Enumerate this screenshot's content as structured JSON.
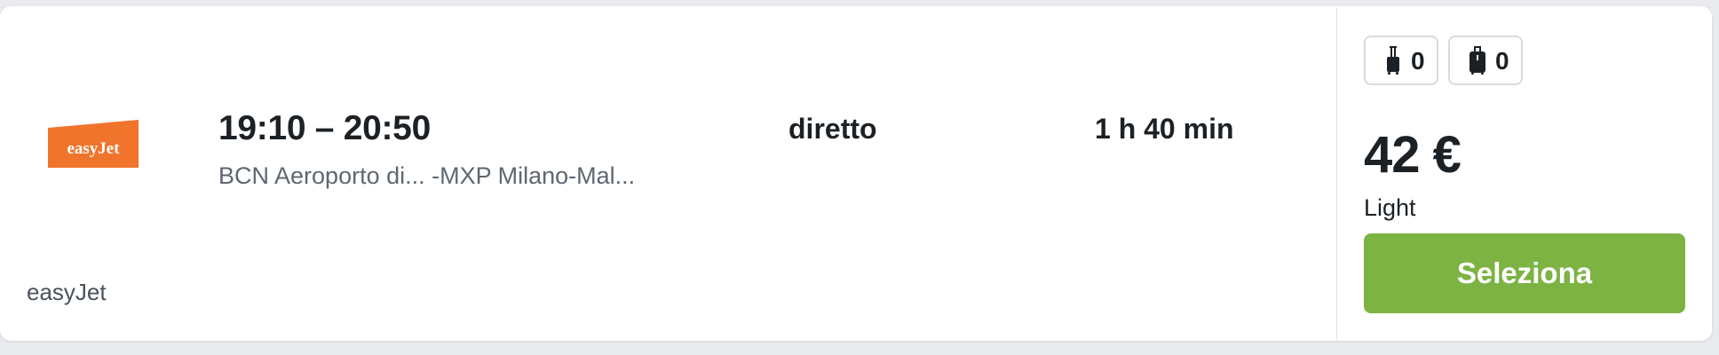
{
  "flight": {
    "airline": {
      "logo_text": "easyJet",
      "name": "easyJet",
      "brand_color": "#f0742c"
    },
    "time_range": "19:10 – 20:50",
    "route": "BCN Aeroporto di... -MXP Milano-Mal...",
    "stops": "diretto",
    "duration": "1 h 40 min"
  },
  "fare": {
    "baggage": [
      {
        "icon": "cabin-bag-icon",
        "count": "0"
      },
      {
        "icon": "checked-bag-icon",
        "count": "0"
      }
    ],
    "price": "42 €",
    "fare_name": "Light",
    "select_label": "Seleziona",
    "button_color": "#7db343"
  }
}
